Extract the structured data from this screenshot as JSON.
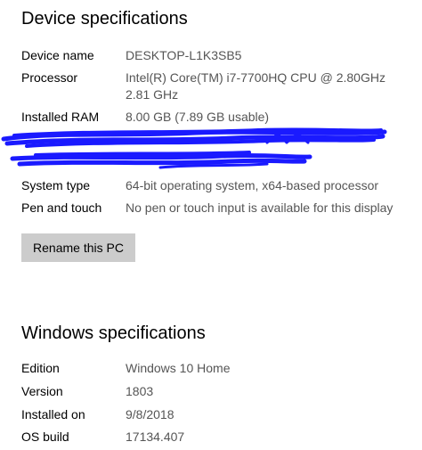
{
  "device_specifications": {
    "title": "Device specifications",
    "rows": [
      {
        "label": "Device name",
        "value": "DESKTOP-L1K3SB5"
      },
      {
        "label": "Processor",
        "value": "Intel(R) Core(TM) i7-7700HQ CPU @ 2.80GHz",
        "value_line2": "2.81 GHz"
      },
      {
        "label": "Installed RAM",
        "value": "8.00 GB (7.89 GB usable)"
      },
      {
        "label": "System type",
        "value": "64-bit operating system, x64-based processor"
      },
      {
        "label": "Pen and touch",
        "value": "No pen or touch input is available for this display"
      }
    ],
    "rename_button_label": "Rename this PC",
    "redaction_color": "#1a1aff"
  },
  "windows_specifications": {
    "title": "Windows specifications",
    "rows": [
      {
        "label": "Edition",
        "value": "Windows 10 Home"
      },
      {
        "label": "Version",
        "value": "1803"
      },
      {
        "label": "Installed on",
        "value": "9/8/2018"
      },
      {
        "label": "OS build",
        "value": "17134.407"
      }
    ]
  },
  "colors": {
    "background": "#ffffff",
    "label_text": "#000000",
    "value_text": "#555555",
    "button_background": "#cccccc"
  }
}
